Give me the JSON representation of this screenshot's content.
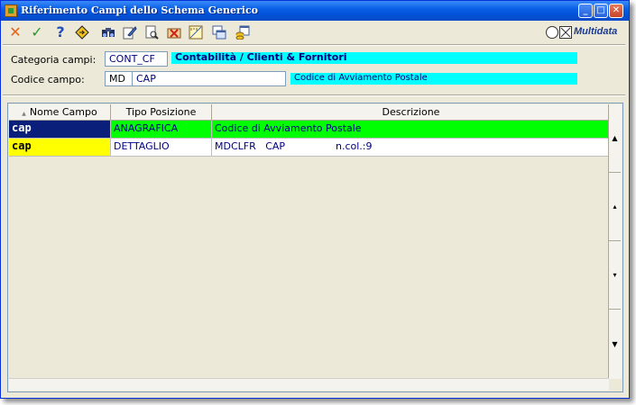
{
  "window": {
    "title": "Riferimento Campi dello Schema Generico"
  },
  "titlebar_buttons": {
    "minimize": "_",
    "maximize": "□",
    "close": "✕"
  },
  "toolbar": {
    "cancel_icon": "✕",
    "confirm_icon": "✓",
    "help_icon": "?",
    "icons": [
      "cancel-icon",
      "confirm-icon",
      "help-icon",
      "diamond-icon",
      "binoculars-icon",
      "edit-icon",
      "print-preview-icon",
      "delete-icon",
      "ruler-icon",
      "window-stack-icon",
      "window-db-icon"
    ]
  },
  "brand": {
    "text": "Multidata"
  },
  "form": {
    "categoria_label": "Categoria campi:",
    "categoria_code": "CONT_CF",
    "categoria_desc": "Contabilità / Clienti & Fornitori",
    "codice_label": "Codice campo:",
    "codice_prefix": "MD",
    "codice_value": "CAP",
    "codice_desc": "Codice di Avviamento Postale"
  },
  "grid": {
    "sort_glyph": "▲",
    "columns": [
      "Nome Campo",
      "Tipo Posizione",
      "Descrizione"
    ],
    "rows": [
      {
        "nome": "cap",
        "tipo": "ANAGRAFICA",
        "descrizione": "Codice di Avviamento Postale",
        "extra": ""
      },
      {
        "nome": "cap",
        "tipo": "DETTAGLIO",
        "descrizione": "MDCLFR   CAP",
        "extra": "n.col.:9"
      }
    ],
    "scroll_glyphs": [
      "▲",
      "▴",
      "▾",
      "▼"
    ]
  },
  "colors": {
    "row1_nome_bg": "#0a1f7a",
    "row1_bg": "#00ff00",
    "row2_nome_bg": "#ffff00",
    "desc_bg": "#00ffff"
  }
}
